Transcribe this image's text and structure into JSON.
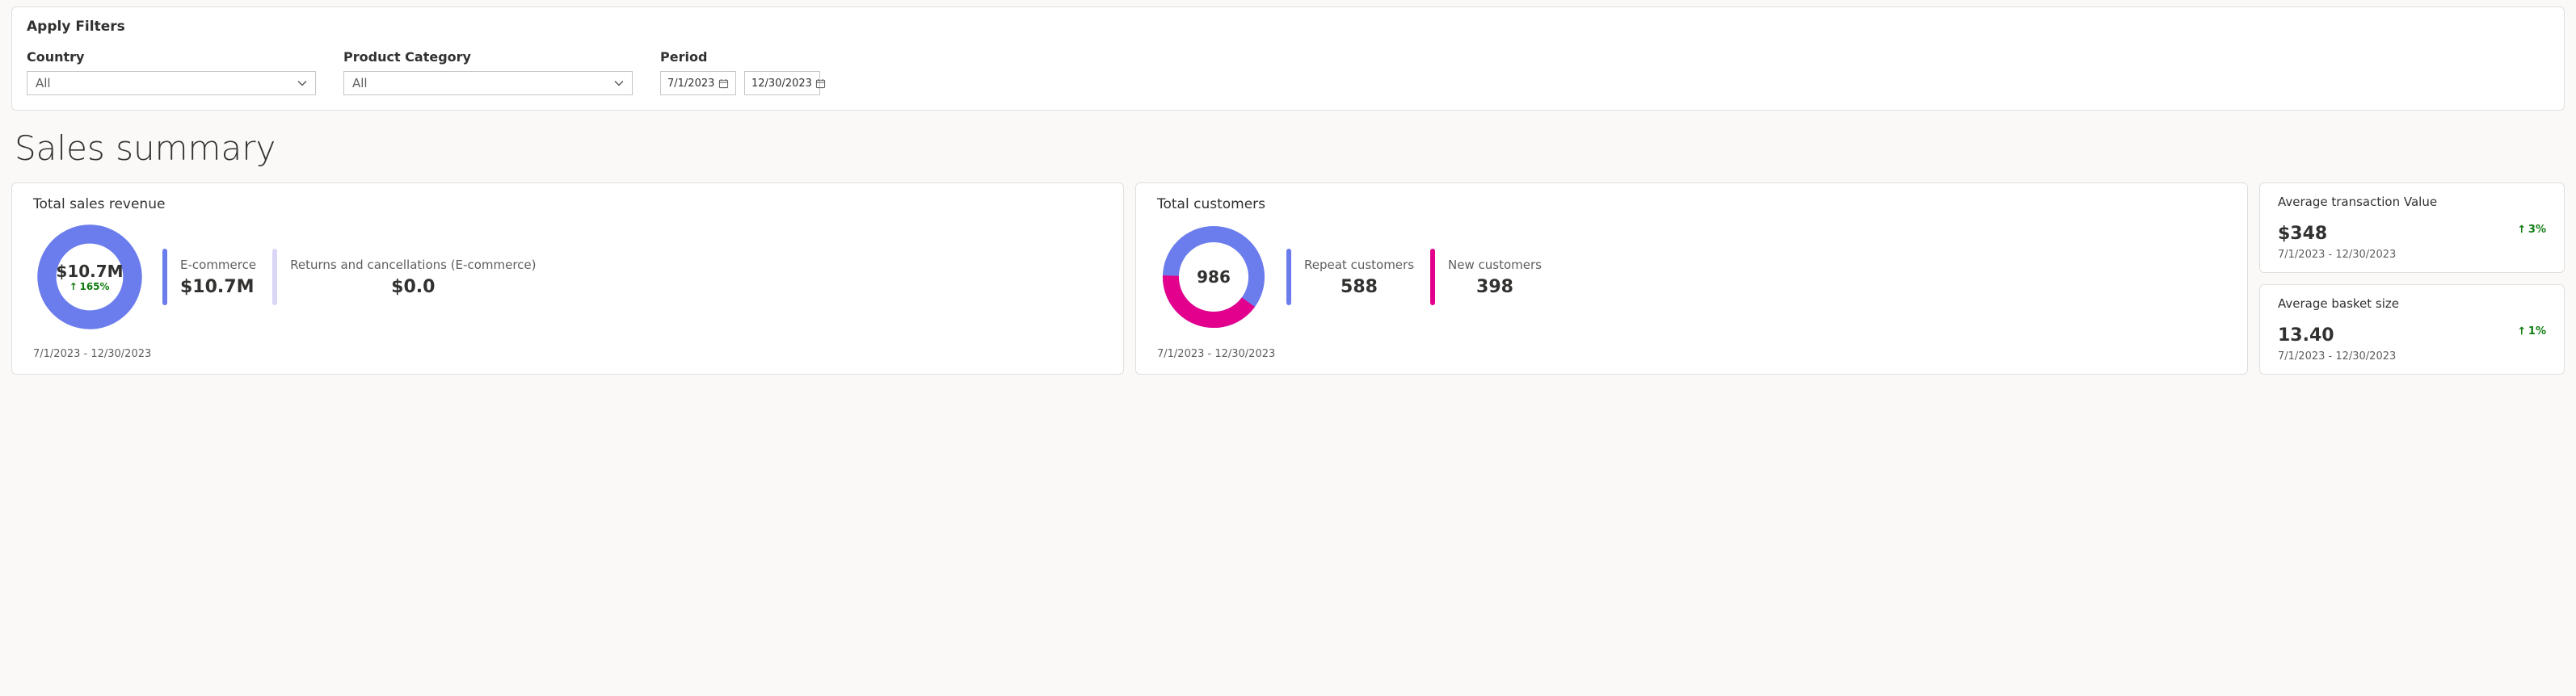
{
  "filters": {
    "title": "Apply Filters",
    "country": {
      "label": "Country",
      "value": "All"
    },
    "category": {
      "label": "Product Category",
      "value": "All"
    },
    "period": {
      "label": "Period",
      "start": "7/1/2023",
      "end": "12/30/2023"
    }
  },
  "page_title": "Sales summary",
  "revenue": {
    "title": "Total sales revenue",
    "total": "$10.7M",
    "delta": "165%",
    "ecommerce_label": "E-commerce",
    "ecommerce_value": "$10.7M",
    "returns_label": "Returns and cancellations (E-commerce)",
    "returns_value": "$0.0",
    "range": "7/1/2023 - 12/30/2023"
  },
  "customers": {
    "title": "Total customers",
    "total": "986",
    "repeat_label": "Repeat customers",
    "repeat_value": "588",
    "new_label": "New customers",
    "new_value": "398",
    "range": "7/1/2023 - 12/30/2023"
  },
  "avg_transaction": {
    "title": "Average transaction Value",
    "value": "$348",
    "delta": "3%",
    "range": "7/1/2023 - 12/30/2023"
  },
  "avg_basket": {
    "title": "Average basket size",
    "value": "13.40",
    "delta": "1%",
    "range": "7/1/2023 - 12/30/2023"
  },
  "chart_data": [
    {
      "type": "pie",
      "title": "Total sales revenue",
      "series": [
        {
          "name": "E-commerce",
          "value": 10700000,
          "color": "#6b7cec"
        },
        {
          "name": "Returns and cancellations (E-commerce)",
          "value": 0,
          "color": "#d9d7f5"
        }
      ],
      "total_display": "$10.7M",
      "delta_pct": 165,
      "range": [
        "7/1/2023",
        "12/30/2023"
      ]
    },
    {
      "type": "pie",
      "title": "Total customers",
      "series": [
        {
          "name": "Repeat customers",
          "value": 588,
          "color": "#6b7cec"
        },
        {
          "name": "New customers",
          "value": 398,
          "color": "#e3008c"
        }
      ],
      "total_display": "986",
      "range": [
        "7/1/2023",
        "12/30/2023"
      ]
    }
  ]
}
